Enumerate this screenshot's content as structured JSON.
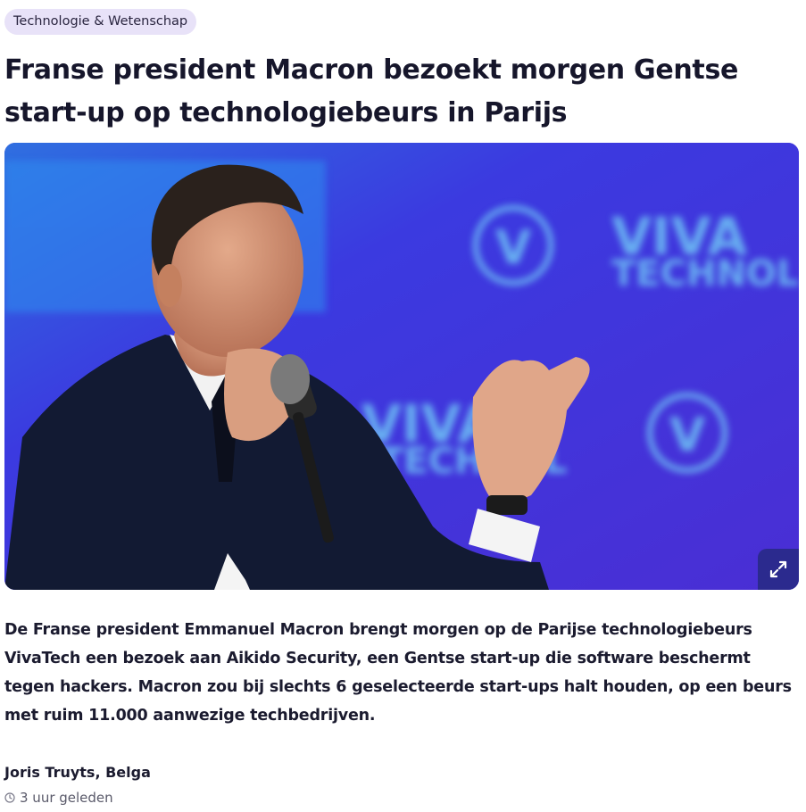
{
  "article": {
    "category": "Technologie & Wetenschap",
    "title": "Franse president Macron bezoekt morgen Gentse start-up op technologiebeurs in Parijs",
    "image": {
      "alt": "Emmanuel Macron spreekt met microfoon voor een blauwe achtergrond met VivaTech-logo's",
      "backdrop_text_1": "VIVA",
      "backdrop_text_2": "TECHNOL",
      "backdrop_text_3": "VIVA",
      "backdrop_text_4": "TECHNOL",
      "backdrop_logo_letter": "V"
    },
    "lead": "De Franse president Emmanuel Macron brengt morgen op de Parijse technologiebeurs VivaTech een bezoek aan Aikido Security, een Gentse start-up die software beschermt tegen hackers. Macron zou bij slechts 6 geselecteerde start-ups halt houden, op een beurs met ruim 11.000 aanwezige techbedrijven.",
    "author": "Joris Truyts, Belga",
    "published": "3 uur geleden"
  },
  "colors": {
    "tag_bg": "#e8e2f8",
    "hero_blue": "#3e2fd6",
    "expand_bg": "#2b2a8e"
  },
  "icons": {
    "expand": "expand-icon",
    "clock": "clock-icon"
  }
}
